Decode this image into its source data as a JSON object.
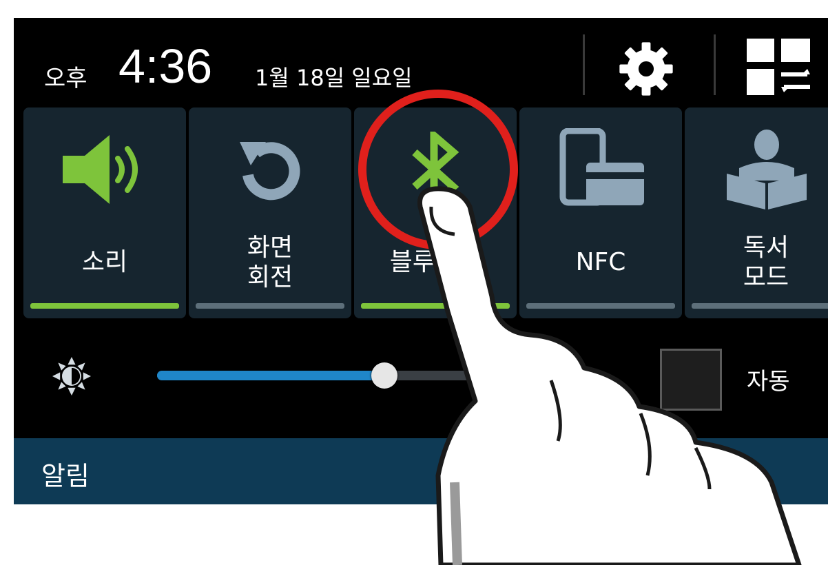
{
  "status_bar": {
    "ampm": "오후",
    "time": "4:36",
    "date": "1월 18일 일요일",
    "settings_icon": "gear-icon",
    "edit_icon": "quick-settings-grid-icon"
  },
  "tiles": [
    {
      "label": "소리",
      "icon": "speaker-icon",
      "active": true
    },
    {
      "label": "화면\n회전",
      "icon": "rotate-icon",
      "active": false
    },
    {
      "label": "블루투스",
      "icon": "bluetooth-icon",
      "active": true
    },
    {
      "label": "NFC",
      "icon": "nfc-icon",
      "active": false
    },
    {
      "label": "독서\n모드",
      "icon": "reading-mode-icon",
      "active": false
    }
  ],
  "brightness": {
    "icon": "brightness-icon",
    "level_fraction": 0.66,
    "auto_label": "자동",
    "auto_checked": false
  },
  "notifications": {
    "title": "알림"
  },
  "colors": {
    "active": "#7ec43b",
    "inactive": "#5d6f7a",
    "tile_bg": "#16252f",
    "slider_fill": "#1f86c8",
    "highlight_circle": "#e0201c",
    "notif_bar": "#0e3a55"
  }
}
